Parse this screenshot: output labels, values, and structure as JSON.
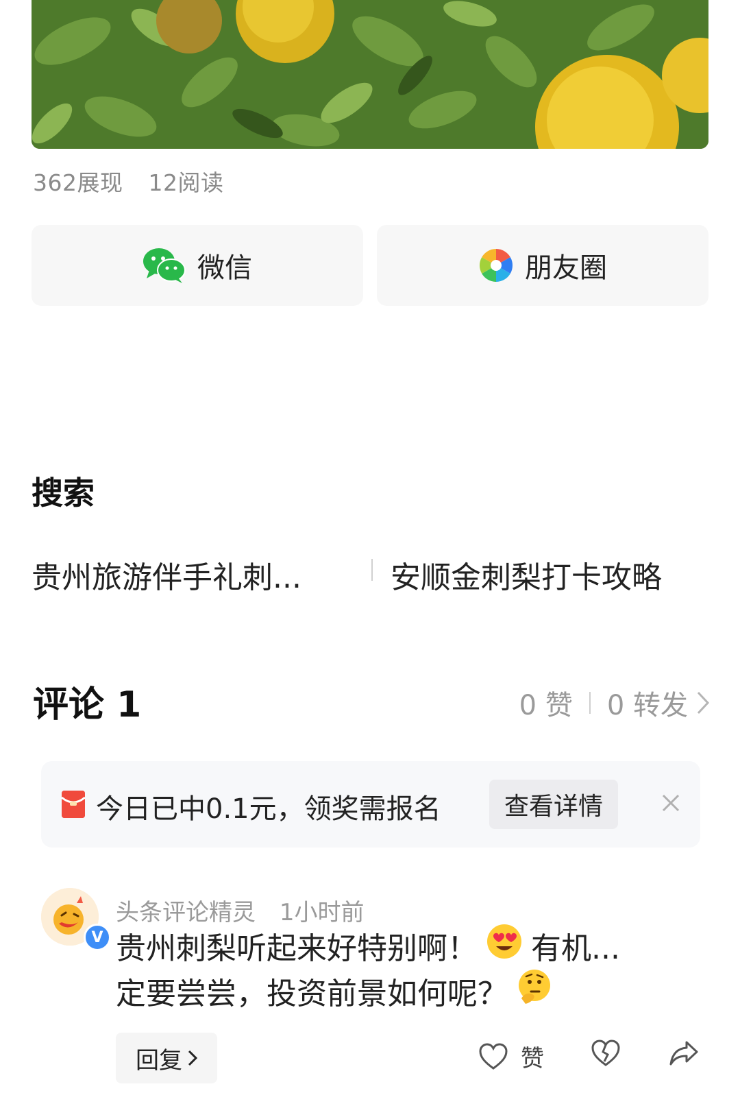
{
  "article": {
    "stats": {
      "views": "362展现",
      "reads": "12阅读"
    },
    "share": {
      "wechat_label": "微信",
      "moments_label": "朋友圈"
    }
  },
  "search": {
    "title": "搜索",
    "suggestions": [
      "贵州旅游伴手礼刺...",
      "安顺金刺梨打卡攻略"
    ]
  },
  "comments": {
    "title": "评论 1",
    "likes": "0 赞",
    "reposts": "0 转发",
    "reward_banner": {
      "text": "今日已中0.1元，领奖需报名",
      "button_label": "查看详情"
    },
    "items": [
      {
        "author": "头条评论精灵",
        "time": "1小时前",
        "line1_part1": "贵州刺梨听起来好特别啊！",
        "line1_part2": "有机...",
        "line2": "定要尝尝，投资前景如何呢？",
        "reply_label": "回复",
        "like_label": "赞"
      }
    ]
  },
  "colors": {
    "wechat_green": "#29b84a",
    "reward_red": "#f04a3c",
    "verified_blue": "#3e8ef7"
  }
}
